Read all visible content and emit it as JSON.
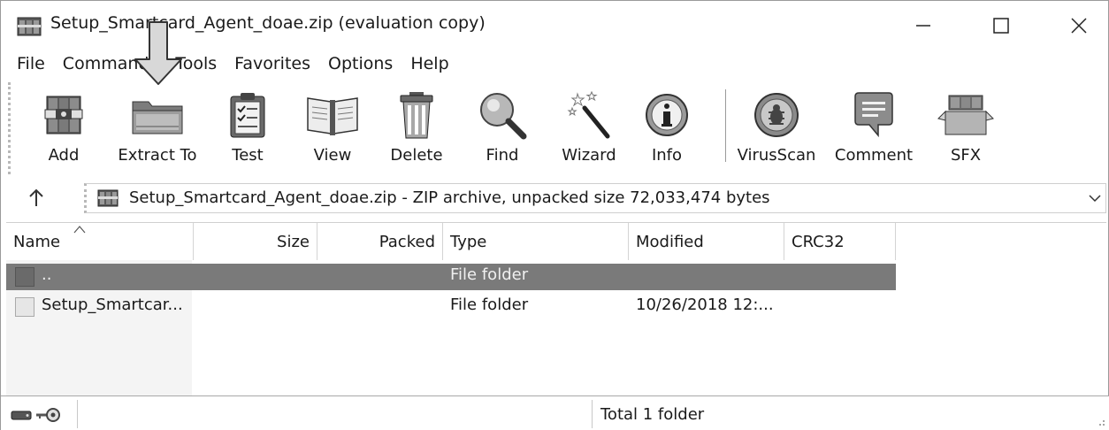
{
  "window": {
    "title": "Setup_Smartcard_Agent_doae.zip (evaluation copy)"
  },
  "menu": [
    "File",
    "Commands",
    "Tools",
    "Favorites",
    "Options",
    "Help"
  ],
  "toolbar": {
    "buttons": [
      {
        "label": "Add",
        "icon": "add-archive-icon"
      },
      {
        "label": "Extract To",
        "icon": "extract-folder-icon"
      },
      {
        "label": "Test",
        "icon": "test-clipboard-icon"
      },
      {
        "label": "View",
        "icon": "view-book-icon"
      },
      {
        "label": "Delete",
        "icon": "trash-icon"
      },
      {
        "label": "Find",
        "icon": "magnifier-icon"
      },
      {
        "label": "Wizard",
        "icon": "magic-wand-icon"
      },
      {
        "label": "Info",
        "icon": "info-icon"
      },
      {
        "label": "VirusScan",
        "icon": "virus-scan-icon"
      },
      {
        "label": "Comment",
        "icon": "comment-icon"
      },
      {
        "label": "SFX",
        "icon": "sfx-box-icon"
      }
    ]
  },
  "address": {
    "text": "Setup_Smartcard_Agent_doae.zip - ZIP archive, unpacked size 72,033,474 bytes"
  },
  "columns": {
    "name": "Name",
    "size": "Size",
    "packed": "Packed",
    "type": "Type",
    "modified": "Modified",
    "crc": "CRC32"
  },
  "rows": [
    {
      "name": "..",
      "size": "",
      "packed": "",
      "type": "File folder",
      "modified": "",
      "crc": "",
      "selected": true
    },
    {
      "name": "Setup_Smartcar...",
      "size": "",
      "packed": "",
      "type": "File folder",
      "modified": "10/26/2018 12:...",
      "crc": "",
      "selected": false
    }
  ],
  "status": {
    "text": "Total 1 folder"
  }
}
